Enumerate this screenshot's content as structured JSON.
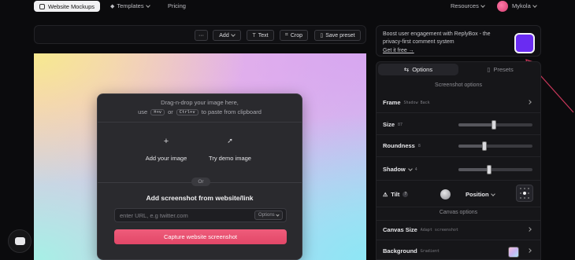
{
  "nav": {
    "brand": "Website Mockups",
    "templates": "Templates",
    "pricing": "Pricing",
    "resources": "Resources",
    "user": "Mykola"
  },
  "toolbar": {
    "more": "···",
    "add": "Add",
    "text": "Text",
    "crop": "Crop",
    "save_preset": "Save preset"
  },
  "drop": {
    "line1": "Drag-n-drop your image here,",
    "line2_pre": "use",
    "key1": "⌘+v",
    "line2_or": "or",
    "key2": "Ctrl+v",
    "line2_post": "to paste from clipboard",
    "add_image": "Add your image",
    "demo_image": "Try demo image",
    "or": "Or",
    "url_title": "Add screenshot from website/link",
    "url_placeholder": "enter URL, e.g twitter.com",
    "options": "Options",
    "capture": "Capture website screenshot"
  },
  "ad": {
    "text": "Boost user engagement with ReplyBox - the privacy-first comment system",
    "link": "Get it free →"
  },
  "panel": {
    "tab_options": "Options",
    "tab_presets": "Presets",
    "screenshot_options": "Screenshot options",
    "frame": {
      "label": "Frame",
      "value": "Shadow Back"
    },
    "size": {
      "label": "Size",
      "value": "87",
      "level": 0.48
    },
    "roundness": {
      "label": "Roundness",
      "value": "8",
      "level": 0.35
    },
    "shadow": {
      "label": "Shadow",
      "value": "4",
      "level": 0.41
    },
    "tilt": {
      "label": "Tilt",
      "help": "?"
    },
    "position": "Position",
    "canvas_options": "Canvas options",
    "canvas_size": {
      "label": "Canvas Size",
      "value": "Adapt screenshot"
    },
    "background": {
      "label": "Background",
      "value": "Gradient"
    }
  },
  "colors": {
    "accent": "#e24768",
    "ad_logo": "#6a2cf2",
    "arrow": "#c8375a"
  }
}
